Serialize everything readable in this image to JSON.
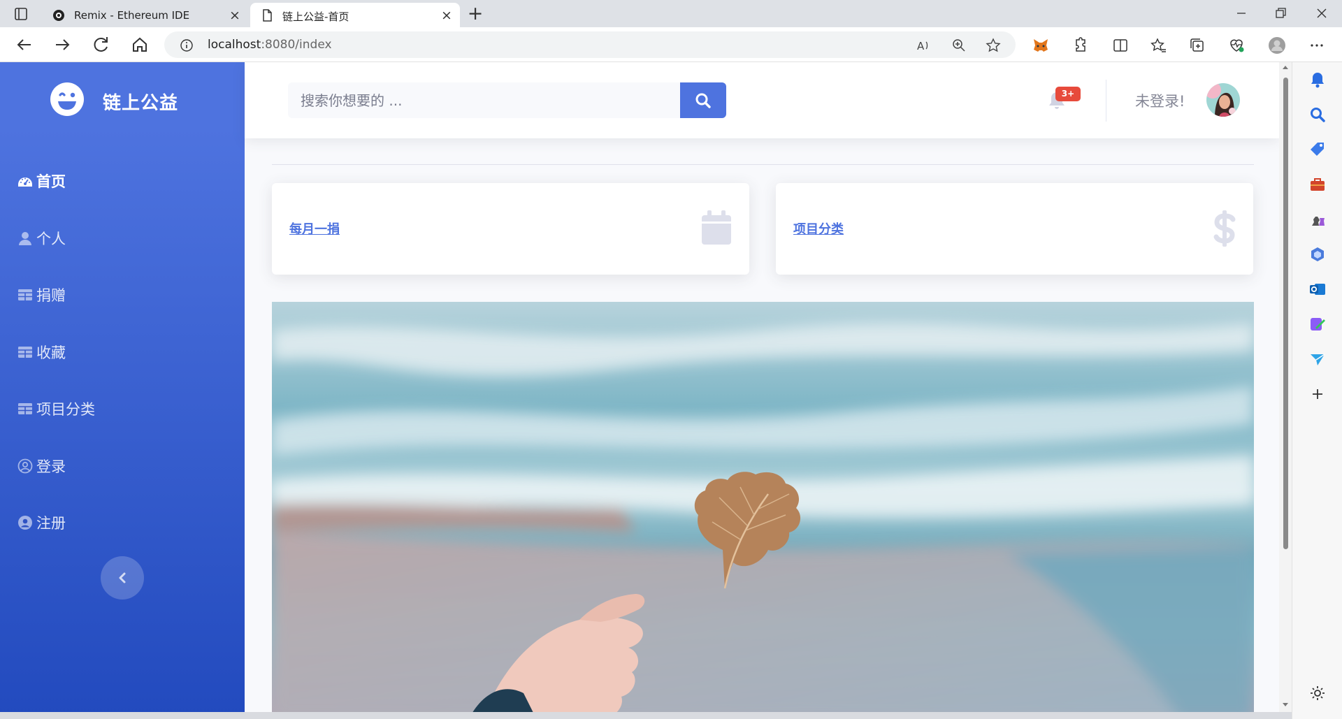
{
  "browser": {
    "tabs": [
      {
        "title": "Remix - Ethereum IDE",
        "icon": "remix-icon"
      },
      {
        "title": "链上公益-首页",
        "icon": "page-icon",
        "active": true
      }
    ],
    "url_host": "localhost",
    "url_rest": ":8080/index",
    "accent": "#4e73df"
  },
  "sidebar": {
    "brand": "链上公益",
    "items": [
      {
        "label": "首页",
        "icon": "dashboard-icon",
        "active": true
      },
      {
        "label": "个人",
        "icon": "user-icon"
      },
      {
        "label": "捐赠",
        "icon": "table-icon"
      },
      {
        "label": "收藏",
        "icon": "table-icon"
      },
      {
        "label": "项目分类",
        "icon": "table-icon"
      },
      {
        "label": "登录",
        "icon": "user-circle-icon"
      },
      {
        "label": "注册",
        "icon": "user-circle-icon"
      }
    ],
    "toggle_icon": "chevron-left-icon"
  },
  "topbar": {
    "search_placeholder": "搜索你想要的 ...",
    "alerts_badge": "3+",
    "user_status": "未登录!"
  },
  "cards": [
    {
      "label": "每月一捐",
      "icon": "calendar-icon"
    },
    {
      "label": "项目分类",
      "icon": "dollar-icon"
    }
  ]
}
